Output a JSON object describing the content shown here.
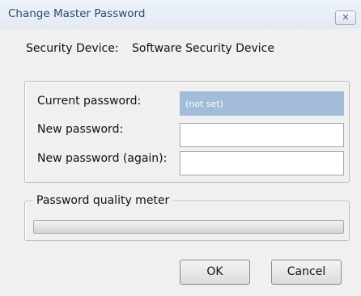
{
  "window": {
    "title": "Change Master Password",
    "close_glyph": "✕"
  },
  "device": {
    "label": "Security Device:",
    "value": "Software Security Device"
  },
  "form": {
    "current_label": "Current password:",
    "current_value": "(not set)",
    "new_label": "New password:",
    "new_value": "",
    "again_label": "New password (again):",
    "again_value": ""
  },
  "meter": {
    "legend": "Password quality meter",
    "level": 0
  },
  "buttons": {
    "ok": "OK",
    "cancel": "Cancel"
  }
}
